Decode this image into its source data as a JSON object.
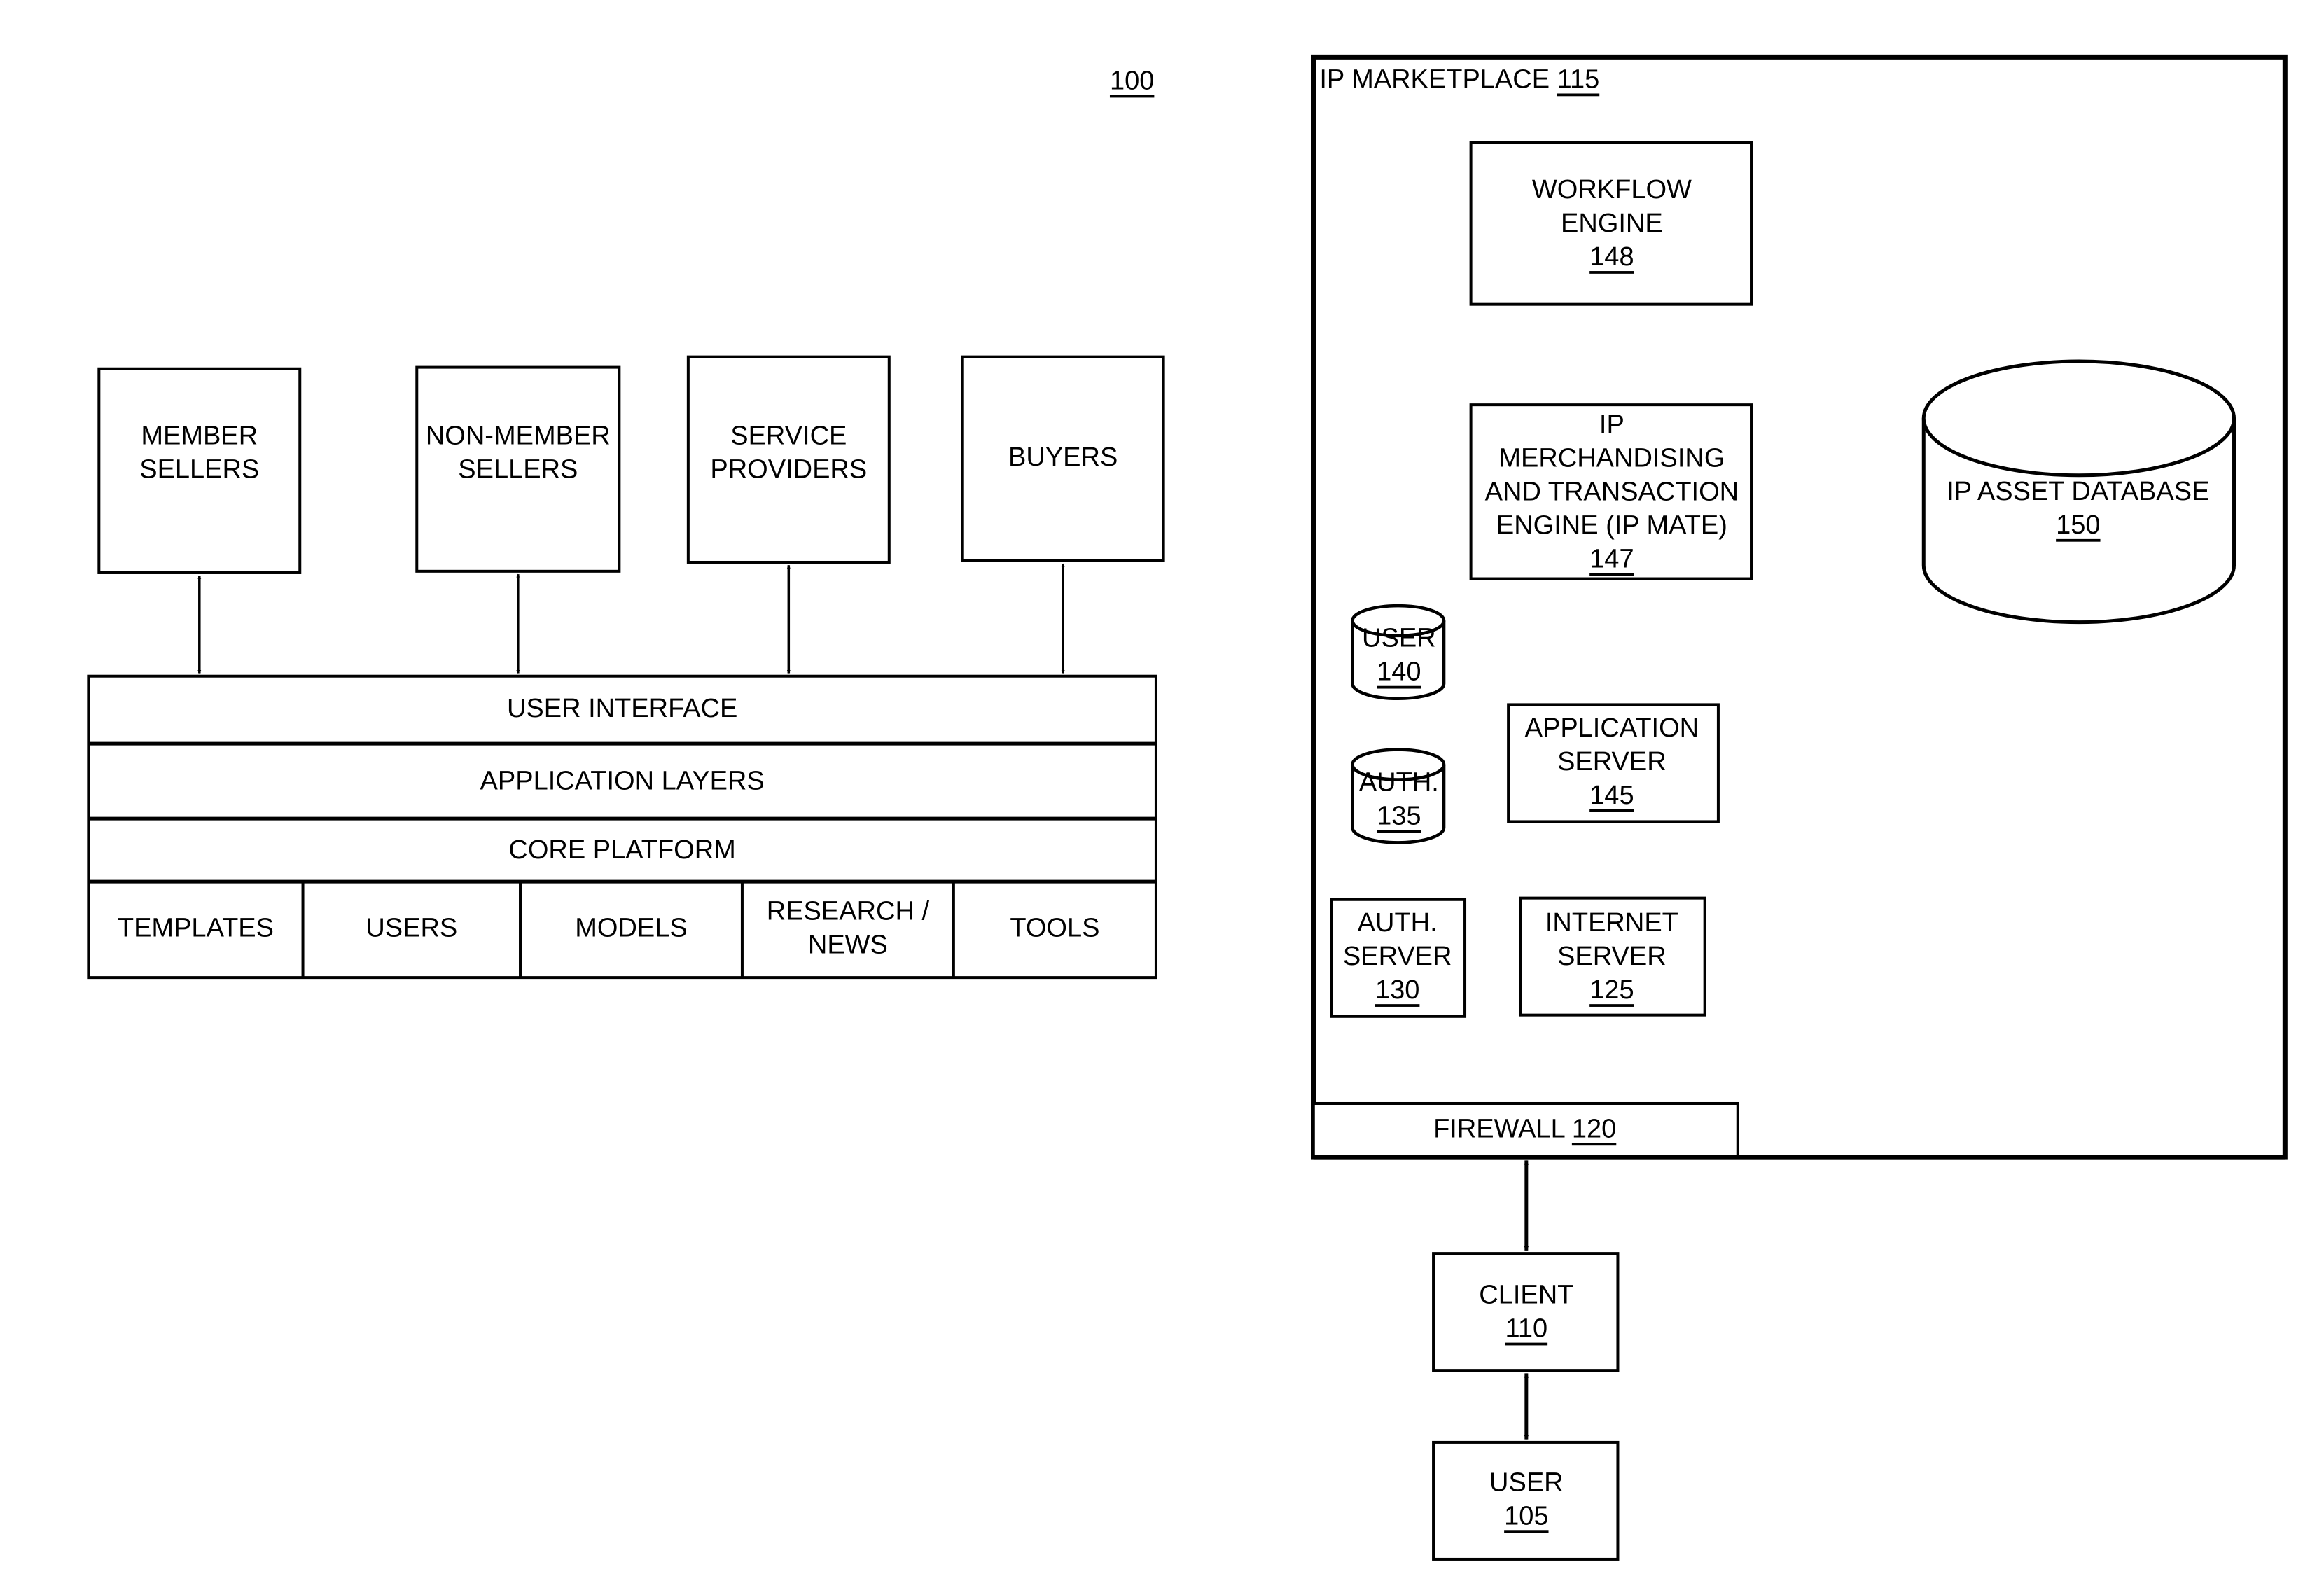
{
  "figure_ref": "100",
  "left": {
    "actors": [
      {
        "id": "member-sellers",
        "lines": [
          "MEMBER",
          "SELLERS"
        ]
      },
      {
        "id": "non-member-sellers",
        "lines": [
          "NON-MEMBER",
          "SELLERS"
        ]
      },
      {
        "id": "service-providers",
        "lines": [
          "SERVICE",
          "PROVIDERS"
        ]
      },
      {
        "id": "buyers",
        "lines": [
          "BUYERS"
        ]
      }
    ],
    "layers": [
      "USER INTERFACE",
      "APPLICATION LAYERS",
      "CORE PLATFORM"
    ],
    "modules": [
      {
        "id": "templates",
        "lines": [
          "TEMPLATES"
        ]
      },
      {
        "id": "users",
        "lines": [
          "USERS"
        ]
      },
      {
        "id": "models",
        "lines": [
          "MODELS"
        ]
      },
      {
        "id": "research-news",
        "lines": [
          "RESEARCH /",
          "NEWS"
        ]
      },
      {
        "id": "tools",
        "lines": [
          "TOOLS"
        ]
      }
    ]
  },
  "marketplace": {
    "title": "IP MARKETPLACE",
    "ref": "115",
    "workflow": {
      "lines": [
        "WORKFLOW",
        "ENGINE"
      ],
      "ref": "148"
    },
    "ipmate": {
      "lines": [
        "IP",
        "MERCHANDISING",
        "AND TRANSACTION",
        "ENGINE (IP MATE)"
      ],
      "ref": "147"
    },
    "database": {
      "lines": [
        "IP ASSET DATABASE"
      ],
      "ref": "150"
    },
    "user_db": {
      "lines": [
        "USER"
      ],
      "ref": "140"
    },
    "auth_db": {
      "lines": [
        "AUTH."
      ],
      "ref": "135"
    },
    "app_server": {
      "lines": [
        "APPLICATION",
        "SERVER"
      ],
      "ref": "145"
    },
    "auth_server": {
      "lines": [
        "AUTH.",
        "SERVER"
      ],
      "ref": "130"
    },
    "internet_server": {
      "lines": [
        "INTERNET",
        "SERVER"
      ],
      "ref": "125"
    },
    "firewall": {
      "label": "FIREWALL",
      "ref": "120"
    }
  },
  "outside": {
    "client": {
      "lines": [
        "CLIENT"
      ],
      "ref": "110"
    },
    "user": {
      "lines": [
        "USER"
      ],
      "ref": "105"
    }
  }
}
